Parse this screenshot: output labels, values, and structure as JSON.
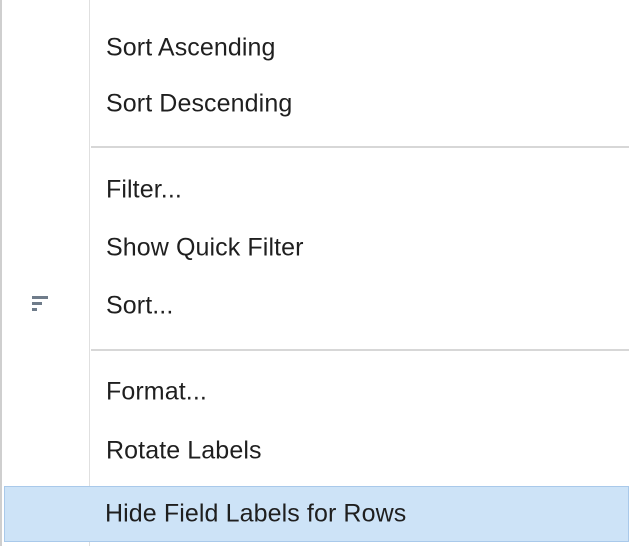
{
  "menu": {
    "items": [
      {
        "label": "Sort Ascending"
      },
      {
        "label": "Sort Descending"
      },
      {
        "label": "Filter..."
      },
      {
        "label": "Show Quick Filter"
      },
      {
        "label": "Sort...",
        "icon": "sort-icon"
      },
      {
        "label": "Format..."
      },
      {
        "label": "Rotate Labels"
      },
      {
        "label": "Hide Field Labels for Rows",
        "highlighted": true
      }
    ]
  },
  "colors": {
    "highlight_bg": "#cde3f7",
    "highlight_border": "#a9c9ea",
    "separator": "#d7d7d7",
    "text": "#1f1f1f",
    "icon": "#6f7c8a"
  }
}
